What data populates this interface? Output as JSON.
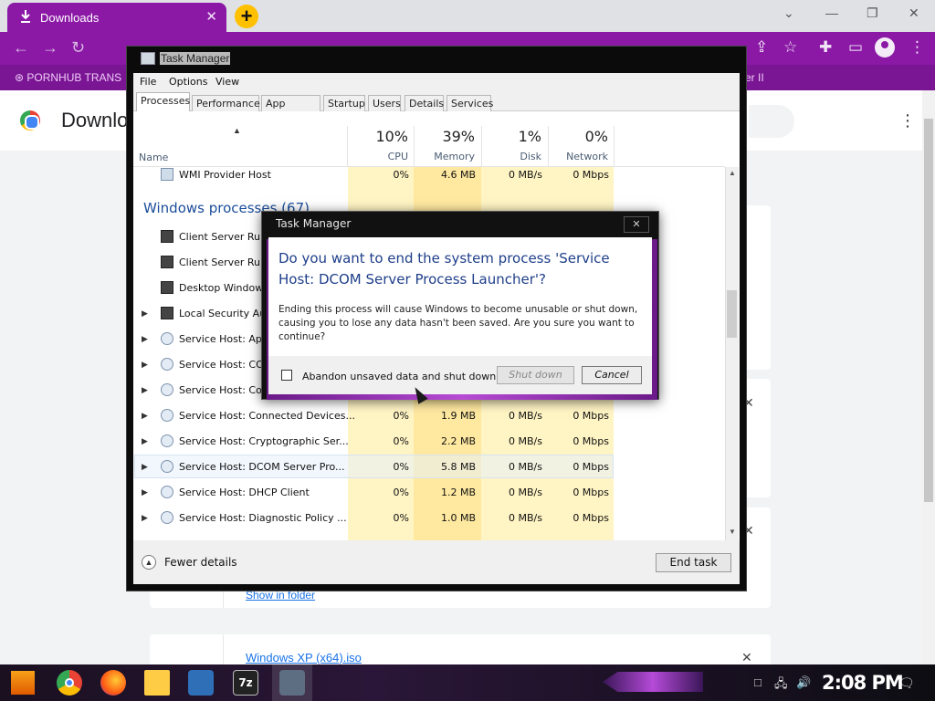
{
  "chrome": {
    "tab_title": "Downloads",
    "tab_close": "✕",
    "new_tab": "+",
    "window_controls": [
      "⌄",
      "—",
      "❐",
      "✕"
    ],
    "nav": {
      "back": "←",
      "forward": "→",
      "reload": "↻"
    },
    "toolbar_icons": [
      "share-icon",
      "star-icon",
      "extensions-icon",
      "sidebar-icon",
      "profile-icon",
      "menu-icon"
    ],
    "bookmark_left": "PORNHUB TRANS",
    "bookmark_right": "er II"
  },
  "page": {
    "title": "Downlo",
    "menu": "⋮",
    "card_close": "✕",
    "show_in_folder": "Show in folder",
    "file_link": "Windows XP (x64).iso"
  },
  "task_manager": {
    "title": "Task Manager",
    "menu": [
      "File",
      "Options",
      "View"
    ],
    "tabs": [
      "Processes",
      "Performance",
      "App history",
      "Startup",
      "Users",
      "Details",
      "Services"
    ],
    "active_tab": "Processes",
    "columns": {
      "name": "Name",
      "cpu_pct": "10%",
      "cpu": "CPU",
      "mem_pct": "39%",
      "mem": "Memory",
      "disk_pct": "1%",
      "disk": "Disk",
      "net_pct": "0%",
      "net": "Network"
    },
    "section_heading": "Windows processes (67)",
    "rows": [
      {
        "name": "WMI Provider Host",
        "cpu": "0%",
        "mem": "4.6 MB",
        "disk": "0 MB/s",
        "net": "0 Mbps"
      },
      {
        "name": "Client Server Runtime Process"
      },
      {
        "name": "Client Server Runtime Process"
      },
      {
        "name": "Desktop Window Manager"
      },
      {
        "name": "Local Security Authority Process"
      },
      {
        "name": "Service Host: Application Information"
      },
      {
        "name": "Service Host: COM+ Event System"
      },
      {
        "name": "Service Host: Connected Devices Platform"
      },
      {
        "name": "Service Host: Connected Devices...",
        "cpu": "0%",
        "mem": "1.9 MB",
        "disk": "0 MB/s",
        "net": "0 Mbps"
      },
      {
        "name": "Service Host: Cryptographic Ser...",
        "cpu": "0%",
        "mem": "2.2 MB",
        "disk": "0 MB/s",
        "net": "0 Mbps"
      },
      {
        "name": "Service Host: DCOM Server Pro...",
        "cpu": "0%",
        "mem": "5.8 MB",
        "disk": "0 MB/s",
        "net": "0 Mbps"
      },
      {
        "name": "Service Host: DHCP Client",
        "cpu": "0%",
        "mem": "1.2 MB",
        "disk": "0 MB/s",
        "net": "0 Mbps"
      },
      {
        "name": "Service Host: Diagnostic Policy ...",
        "cpu": "0%",
        "mem": "1.0 MB",
        "disk": "0 MB/s",
        "net": "0 Mbps"
      }
    ],
    "row_name_visible": [
      "WMI Provider Host",
      "Client Server Run",
      "Client Server Run",
      "Desktop Window",
      "Local Security Au",
      "Service Host: App",
      "Service Host: CO",
      "Service Host: Cor",
      "Service Host: Connected Devices...",
      "Service Host: Cryptographic Ser...",
      "Service Host: DCOM Server Pro...",
      "Service Host: DHCP Client",
      "Service Host: Diagnostic Policy ..."
    ],
    "fewer_details": "Fewer details",
    "end_task": "End task"
  },
  "dialog": {
    "title": "Task Manager",
    "close": "✕",
    "heading": "Do you want to end the system process 'Service Host: DCOM Server Process Launcher'?",
    "body": "Ending this process will cause Windows to become unusable or shut down, causing you to lose any data hasn't been saved. Are you sure you want to continue?",
    "checkbox_label": "Abandon unsaved data and shut down.",
    "shutdown": "Shut down",
    "cancel": "Cancel"
  },
  "taskbar": {
    "apps": [
      "chrome-icon",
      "firefox-icon",
      "file-explorer-icon",
      "virtualbox-icon",
      "7zip-icon",
      "task-manager-icon"
    ],
    "sevenzip": "7z",
    "clock": "2:08 PM",
    "tray": [
      "□",
      "🖧",
      "🔊"
    ],
    "notification": "🗨"
  }
}
